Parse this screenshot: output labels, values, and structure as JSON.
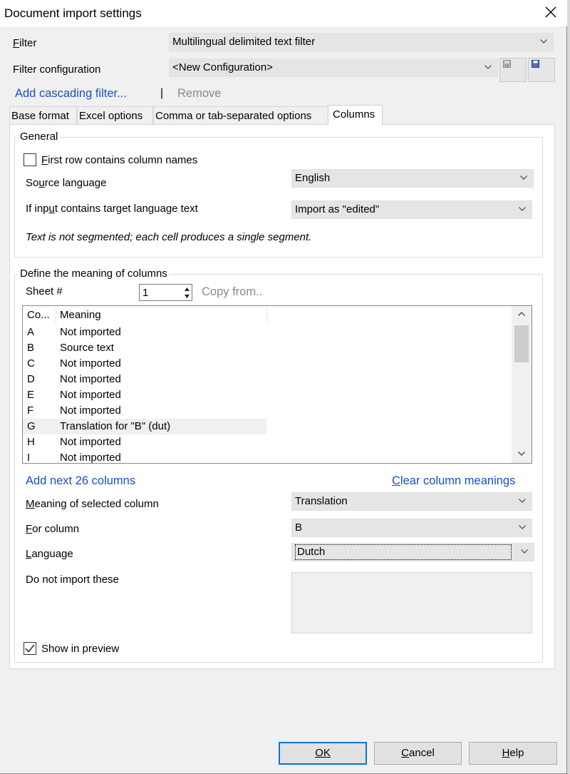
{
  "window": {
    "title": "Document import settings"
  },
  "filter": {
    "label": "Filter",
    "value": "Multilingual delimited text filter"
  },
  "filter_config": {
    "label": "Filter configuration",
    "value": "<New Configuration>"
  },
  "cascading": {
    "add_label": "Add cascading filter...",
    "separator": "|",
    "remove_label": "Remove"
  },
  "tabs": [
    {
      "label": "Base format"
    },
    {
      "label": "Excel options"
    },
    {
      "label": "Comma or tab-separated options"
    },
    {
      "label": "Columns"
    }
  ],
  "general": {
    "group_label": "General",
    "first_row_label": "First row contains column names",
    "first_row_checked": false,
    "source_language_label": "Source language",
    "source_language_value": "English",
    "target_text_label": "If input contains target language text",
    "target_text_value": "Import as \"edited\"",
    "note": "Text is not segmented; each cell produces a single segment."
  },
  "columns": {
    "group_label": "Define the meaning of columns",
    "sheet_label": "Sheet #",
    "sheet_value": "1",
    "copy_from": "Copy from..",
    "header_col1": "Co...",
    "header_col2": "Meaning",
    "rows": [
      {
        "col": "A",
        "meaning": "Not imported"
      },
      {
        "col": "B",
        "meaning": "Source text"
      },
      {
        "col": "C",
        "meaning": "Not imported"
      },
      {
        "col": "D",
        "meaning": "Not imported"
      },
      {
        "col": "E",
        "meaning": "Not imported"
      },
      {
        "col": "F",
        "meaning": "Not imported"
      },
      {
        "col": "G",
        "meaning": "Translation for \"B\" (dut)",
        "selected": true
      },
      {
        "col": "H",
        "meaning": "Not imported"
      },
      {
        "col": "I",
        "meaning": "Not imported"
      }
    ],
    "add_next": "Add next 26 columns",
    "clear_meanings": "Clear column meanings",
    "meaning_label": "Meaning of selected column",
    "meaning_value": "Translation",
    "for_column_label": "For column",
    "for_column_value": "B",
    "language_label": "Language",
    "language_value": "Dutch",
    "do_not_import_label": "Do not import these",
    "do_not_import_value": "",
    "show_preview_label": "Show in preview",
    "show_preview_checked": true
  },
  "buttons": {
    "ok": "OK",
    "cancel": "Cancel",
    "help": "Help"
  },
  "colors": {
    "link": "#1a4fc7",
    "default_button_border": "#0078d7",
    "dialog_bg": "#f0f0f0"
  }
}
